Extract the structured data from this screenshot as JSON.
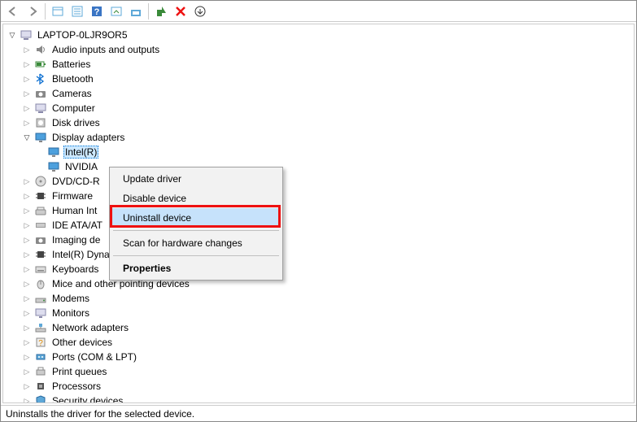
{
  "root": {
    "label": "LAPTOP-0LJR9OR5"
  },
  "categories": [
    {
      "label": "Audio inputs and outputs",
      "expanded": false,
      "icon": "speaker"
    },
    {
      "label": "Batteries",
      "expanded": false,
      "icon": "battery"
    },
    {
      "label": "Bluetooth",
      "expanded": false,
      "icon": "bluetooth"
    },
    {
      "label": "Cameras",
      "expanded": false,
      "icon": "camera"
    },
    {
      "label": "Computer",
      "expanded": false,
      "icon": "pc"
    },
    {
      "label": "Disk drives",
      "expanded": false,
      "icon": "disk"
    },
    {
      "label": "Display adapters",
      "expanded": true,
      "icon": "display",
      "children": [
        {
          "label": "Intel(R)",
          "icon": "display",
          "selected": true
        },
        {
          "label": "NVIDIA",
          "icon": "display"
        }
      ]
    },
    {
      "label": "DVD/CD-R",
      "expanded": false,
      "icon": "dvd",
      "truncated": true
    },
    {
      "label": "Firmware",
      "expanded": false,
      "icon": "chip"
    },
    {
      "label": "Human Int",
      "expanded": false,
      "icon": "hid",
      "truncated": true
    },
    {
      "label": "IDE ATA/AT",
      "expanded": false,
      "icon": "ide",
      "truncated": true
    },
    {
      "label": "Imaging de",
      "expanded": false,
      "icon": "camera",
      "truncated": true
    },
    {
      "label": "Intel(R) Dynamic Platform and Thermal Framework",
      "expanded": false,
      "icon": "chip"
    },
    {
      "label": "Keyboards",
      "expanded": false,
      "icon": "keyboard"
    },
    {
      "label": "Mice and other pointing devices",
      "expanded": false,
      "icon": "mouse"
    },
    {
      "label": "Modems",
      "expanded": false,
      "icon": "modem"
    },
    {
      "label": "Monitors",
      "expanded": false,
      "icon": "monitor"
    },
    {
      "label": "Network adapters",
      "expanded": false,
      "icon": "network"
    },
    {
      "label": "Other devices",
      "expanded": false,
      "icon": "other"
    },
    {
      "label": "Ports (COM & LPT)",
      "expanded": false,
      "icon": "port"
    },
    {
      "label": "Print queues",
      "expanded": false,
      "icon": "printer"
    },
    {
      "label": "Processors",
      "expanded": false,
      "icon": "cpu"
    },
    {
      "label": "Security devices",
      "expanded": false,
      "icon": "security"
    }
  ],
  "context_menu": {
    "items": [
      {
        "label": "Update driver",
        "type": "item"
      },
      {
        "label": "Disable device",
        "type": "item"
      },
      {
        "label": "Uninstall device",
        "type": "item",
        "highlighted": true
      },
      {
        "type": "sep"
      },
      {
        "label": "Scan for hardware changes",
        "type": "item"
      },
      {
        "type": "sep"
      },
      {
        "label": "Properties",
        "type": "item",
        "bold": true
      }
    ]
  },
  "status_text": "Uninstalls the driver for the selected device."
}
